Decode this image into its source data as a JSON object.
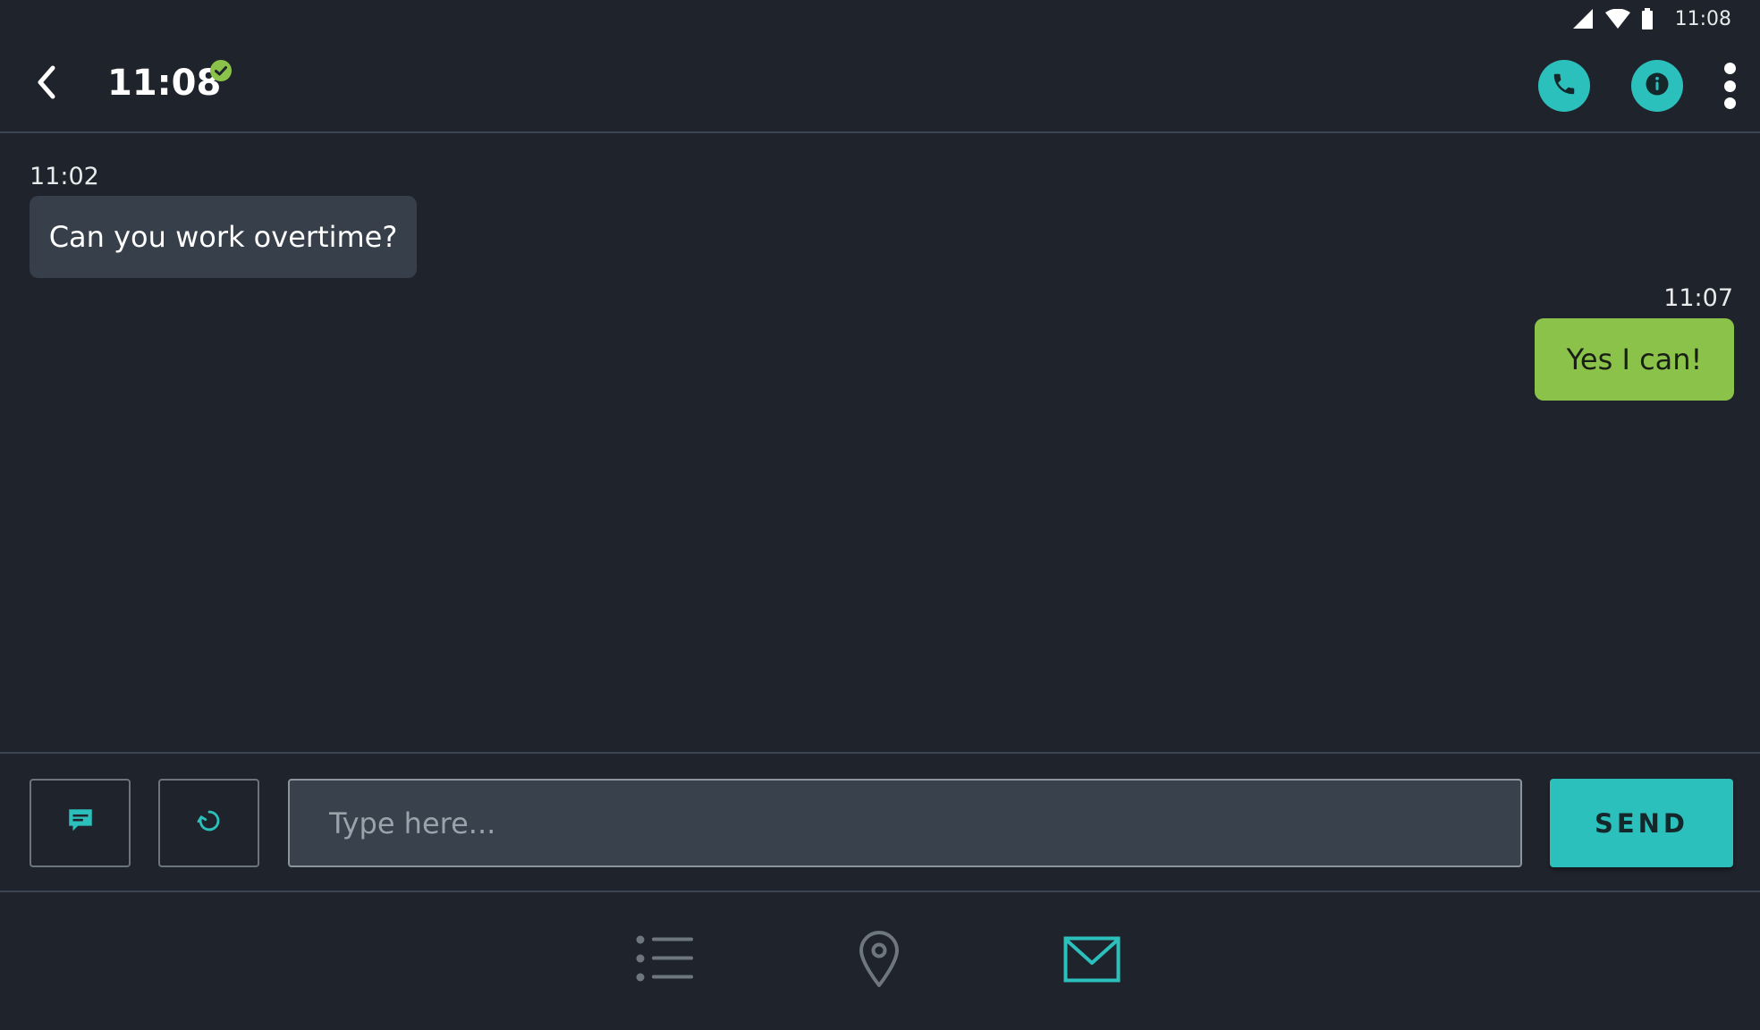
{
  "status_bar": {
    "time": "11:08",
    "icons": [
      "cellular-signal-icon",
      "wifi-icon",
      "battery-icon"
    ]
  },
  "header": {
    "title": "11:08",
    "status": "online",
    "actions": [
      "back-arrow-icon",
      "phone-icon",
      "info-icon",
      "more-vertical-icon"
    ]
  },
  "conversation": {
    "messages": [
      {
        "direction": "incoming",
        "time": "11:02",
        "text": "Can you work overtime?"
      },
      {
        "direction": "outgoing",
        "time": "11:07",
        "text": "Yes I can!"
      }
    ]
  },
  "composer": {
    "placeholder": "Type here...",
    "value": "",
    "send_label": "SEND",
    "tools": [
      "quick-reply-icon",
      "refresh-icon"
    ]
  },
  "bottom_nav": {
    "items": [
      {
        "id": "list",
        "icon": "list-icon",
        "active": false
      },
      {
        "id": "map",
        "icon": "location-pin-icon",
        "active": false
      },
      {
        "id": "messages",
        "icon": "envelope-icon",
        "active": true
      }
    ]
  },
  "colors": {
    "background": "#1f232b",
    "accent": "#2cc0bd",
    "incoming_bubble": "#363f4a",
    "outgoing_bubble": "#8bc34a",
    "online_badge": "#8bc34a",
    "inactive_icon": "#6e767f"
  }
}
